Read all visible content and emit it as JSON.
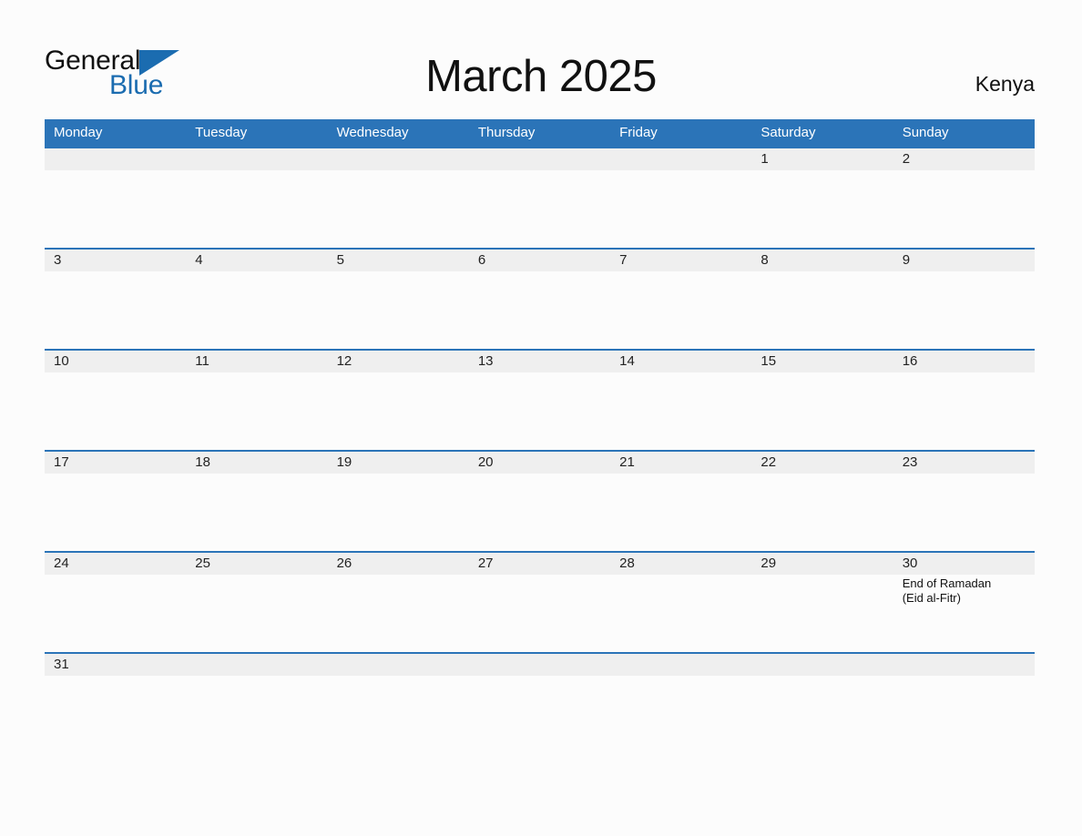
{
  "brand": {
    "line1": "General",
    "line2": "Blue",
    "triangle_icon": "brand-triangle-icon",
    "accent_color": "#1B6CB0"
  },
  "header": {
    "title": "March 2025",
    "country": "Kenya"
  },
  "colors": {
    "header_blue": "#2B74B8",
    "row_band_gray": "#EFEFEF",
    "page_background": "#FCFCFC",
    "text": "#222222"
  },
  "calendar": {
    "weekdays": [
      "Monday",
      "Tuesday",
      "Wednesday",
      "Thursday",
      "Friday",
      "Saturday",
      "Sunday"
    ],
    "weeks": [
      [
        {
          "day": ""
        },
        {
          "day": ""
        },
        {
          "day": ""
        },
        {
          "day": ""
        },
        {
          "day": ""
        },
        {
          "day": "1"
        },
        {
          "day": "2"
        }
      ],
      [
        {
          "day": "3"
        },
        {
          "day": "4"
        },
        {
          "day": "5"
        },
        {
          "day": "6"
        },
        {
          "day": "7"
        },
        {
          "day": "8"
        },
        {
          "day": "9"
        }
      ],
      [
        {
          "day": "10"
        },
        {
          "day": "11"
        },
        {
          "day": "12"
        },
        {
          "day": "13"
        },
        {
          "day": "14"
        },
        {
          "day": "15"
        },
        {
          "day": "16"
        }
      ],
      [
        {
          "day": "17"
        },
        {
          "day": "18"
        },
        {
          "day": "19"
        },
        {
          "day": "20"
        },
        {
          "day": "21"
        },
        {
          "day": "22"
        },
        {
          "day": "23"
        }
      ],
      [
        {
          "day": "24"
        },
        {
          "day": "25"
        },
        {
          "day": "26"
        },
        {
          "day": "27"
        },
        {
          "day": "28"
        },
        {
          "day": "29"
        },
        {
          "day": "30",
          "events": [
            "End of Ramadan",
            "(Eid al-Fitr)"
          ]
        }
      ],
      [
        {
          "day": "31"
        },
        {
          "day": ""
        },
        {
          "day": ""
        },
        {
          "day": ""
        },
        {
          "day": ""
        },
        {
          "day": ""
        },
        {
          "day": ""
        }
      ]
    ]
  }
}
